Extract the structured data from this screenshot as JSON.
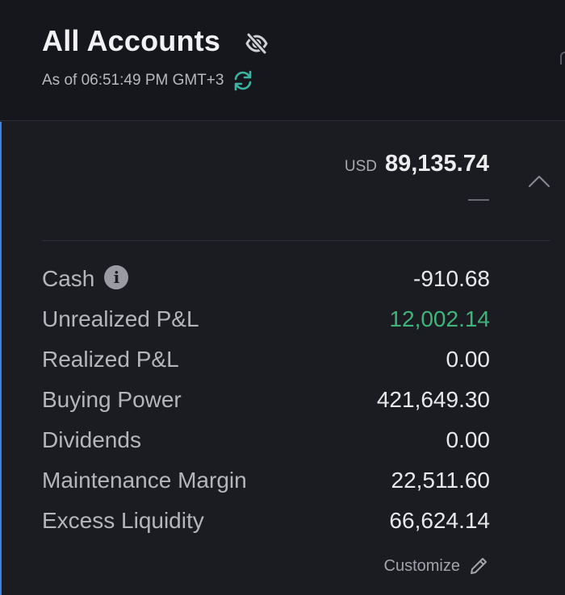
{
  "header": {
    "title": "All Accounts",
    "as_of": "As of 06:51:49 PM GMT+3",
    "icons": {
      "visibility": "eye-off-icon",
      "refresh": "refresh-icon"
    }
  },
  "summary": {
    "currency": "USD",
    "total": "89,135.74",
    "change": "—"
  },
  "rows": [
    {
      "label": "Cash",
      "value": "-910.68",
      "has_info": true
    },
    {
      "label": "Unrealized P&L",
      "value": "12,002.14",
      "positive": true
    },
    {
      "label": "Realized P&L",
      "value": "0.00"
    },
    {
      "label": "Buying Power",
      "value": "421,649.30"
    },
    {
      "label": "Dividends",
      "value": "0.00"
    },
    {
      "label": "Maintenance Margin",
      "value": "22,511.60"
    },
    {
      "label": "Excess Liquidity",
      "value": "66,624.14"
    }
  ],
  "footer": {
    "customize_label": "Customize"
  },
  "colors": {
    "accent": "#3f7fe0",
    "positive": "#3fb37a",
    "refresh": "#3fb3a3"
  }
}
